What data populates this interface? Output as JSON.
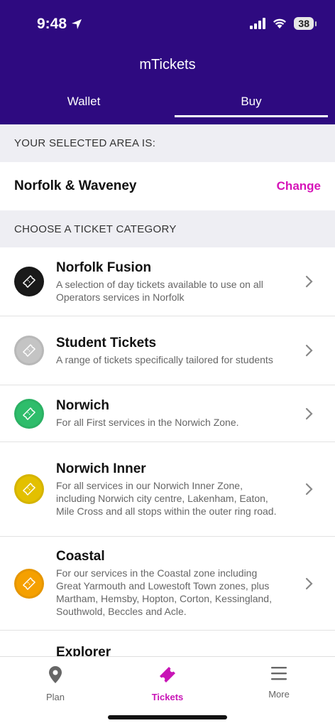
{
  "status_bar": {
    "time": "9:48",
    "battery": "38"
  },
  "header": {
    "title": "mTickets"
  },
  "tabs": [
    {
      "label": "Wallet",
      "active": false
    },
    {
      "label": "Buy",
      "active": true
    }
  ],
  "area_section": {
    "heading": "YOUR SELECTED AREA IS:",
    "area_name": "Norfolk & Waveney",
    "change_label": "Change"
  },
  "category_section": {
    "heading": "CHOOSE A TICKET CATEGORY"
  },
  "categories": [
    {
      "title": "Norfolk Fusion",
      "description": "A selection of day tickets available to use on all Operators services in Norfolk",
      "color": "#1a1a1a"
    },
    {
      "title": "Student Tickets",
      "description": "A range of tickets specifically tailored for students",
      "color": "#c4c4c4"
    },
    {
      "title": "Norwich",
      "description": "For all First services in the Norwich Zone.",
      "color": "#2ebd6b"
    },
    {
      "title": "Norwich Inner",
      "description": "For all services in our Norwich Inner Zone, including Norwich city centre, Lakenham, Eaton, Mile Cross and all stops within the outer ring road.",
      "color": "#e3c000"
    },
    {
      "title": "Coastal",
      "description": "For our services in the Coastal zone including Great Yarmouth and Lowestoft Town zones, plus Martham, Hemsby, Hopton, Corton, Kessingland, Southwold, Beccles and Acle.",
      "color": "#f5a000"
    },
    {
      "title": "Explorer",
      "description": "",
      "color": "#d0d0d0"
    }
  ],
  "tabbar": [
    {
      "label": "Plan",
      "icon": "location-pin-icon",
      "active": false
    },
    {
      "label": "Tickets",
      "icon": "ticket-icon",
      "active": true
    },
    {
      "label": "More",
      "icon": "menu-icon",
      "active": false
    }
  ],
  "colors": {
    "header_bg": "#2e0a80",
    "accent": "#d614b8"
  }
}
